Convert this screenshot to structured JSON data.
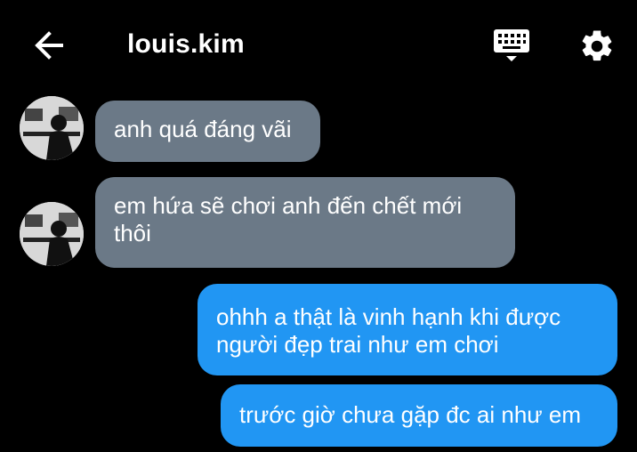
{
  "header": {
    "title": "louis.kim",
    "back_icon": "arrow-left-icon",
    "keyboard_icon": "keyboard-icon",
    "settings_icon": "gear-icon"
  },
  "colors": {
    "background": "#000000",
    "incoming_bubble": "#6b7987",
    "outgoing_bubble": "#2196f3",
    "text": "#ffffff"
  },
  "messages": [
    {
      "direction": "incoming",
      "text": "anh quá đáng vãi"
    },
    {
      "direction": "incoming",
      "text": "em hứa sẽ chơi anh đến chết mới thôi"
    },
    {
      "direction": "outgoing",
      "text": "ohhh a thật là vinh hạnh khi được người đẹp trai như em chơi"
    },
    {
      "direction": "outgoing",
      "text": "trước giờ chưa gặp đc ai như em"
    }
  ]
}
